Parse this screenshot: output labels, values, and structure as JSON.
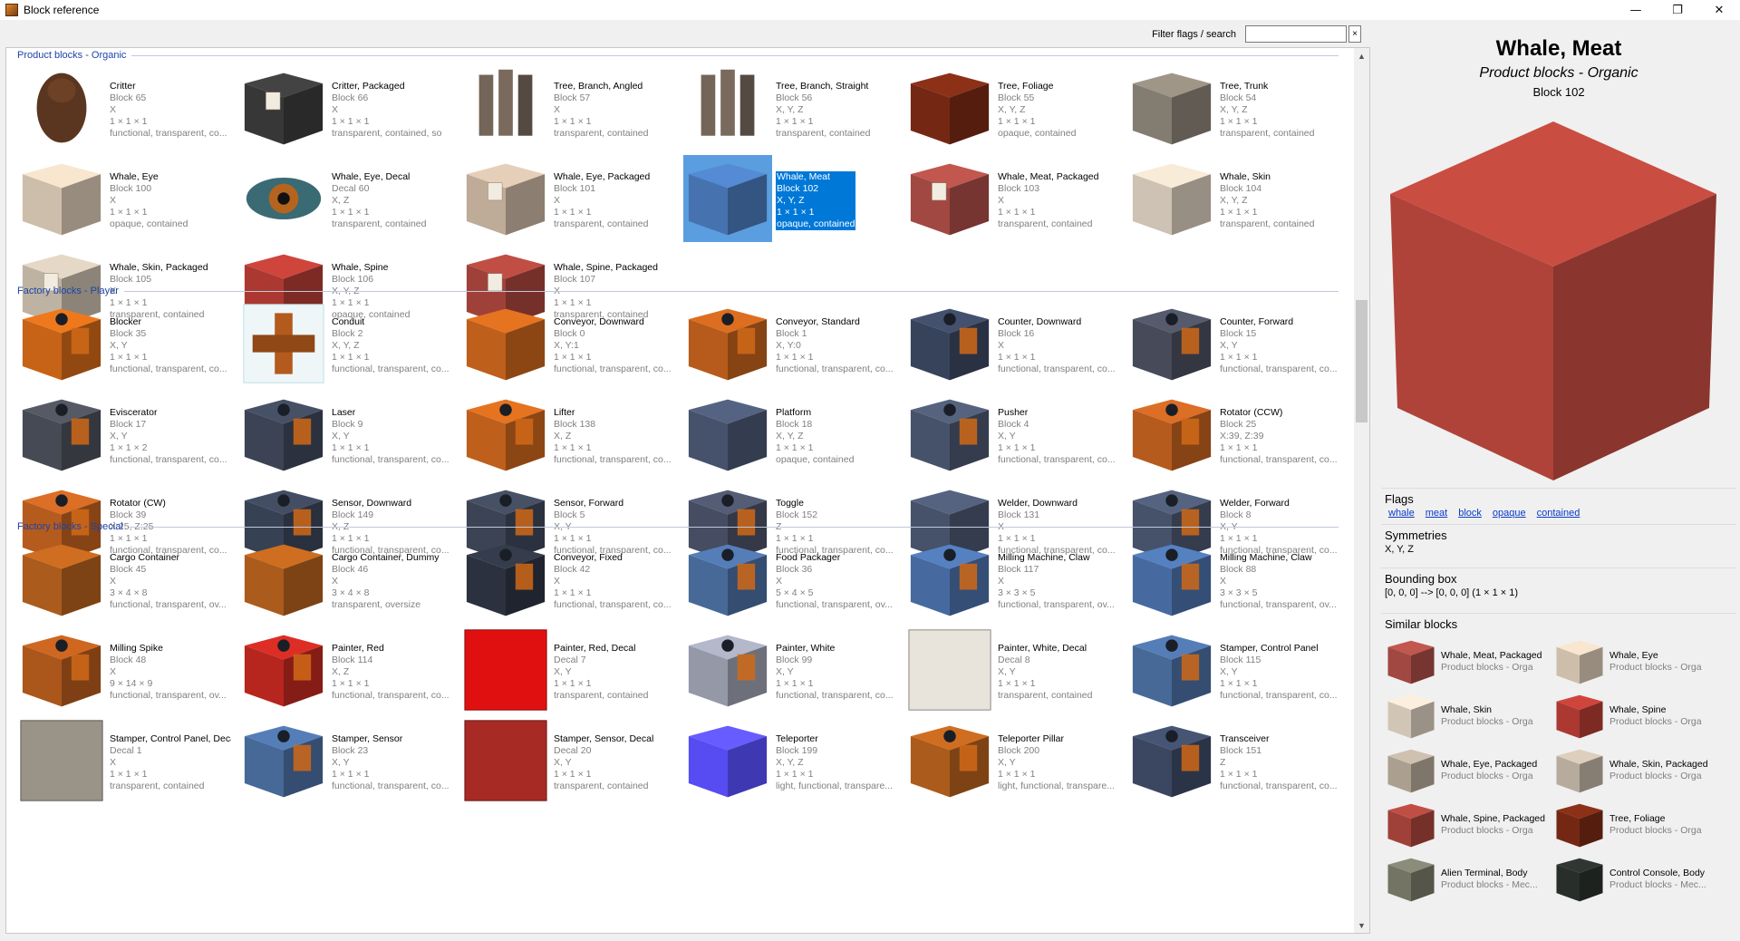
{
  "window": {
    "title": "Block reference",
    "minimize": "—",
    "maximize": "❐",
    "close": "✕"
  },
  "filter": {
    "label": "Filter flags / search",
    "value": "",
    "clear": "×"
  },
  "categories": [
    {
      "title": "Product blocks - Organic",
      "items": [
        {
          "name": "Critter",
          "block": "Block 65",
          "sym": "X",
          "size": "1 × 1 × 1",
          "flags": "functional, transparent, co...",
          "color": "#5a3620",
          "shape": "critter"
        },
        {
          "name": "Critter, Packaged",
          "block": "Block 66",
          "sym": "X",
          "size": "1 × 1 × 1",
          "flags": "transparent, contained, so",
          "color": "#3a3a3a",
          "shape": "package"
        },
        {
          "name": "Tree, Branch, Angled",
          "block": "Block 57",
          "sym": "X",
          "size": "1 × 1 × 1",
          "flags": "transparent, contained",
          "color": "#7a6a5e",
          "shape": "posts"
        },
        {
          "name": "Tree, Branch, Straight",
          "block": "Block 56",
          "sym": "X, Y, Z",
          "size": "1 × 1 × 1",
          "flags": "transparent, contained",
          "color": "#7a6a5e",
          "shape": "posts"
        },
        {
          "name": "Tree, Foliage",
          "block": "Block 55",
          "sym": "X, Y, Z",
          "size": "1 × 1 × 1",
          "flags": "opaque, contained",
          "color": "#7a2a14",
          "shape": "cube"
        },
        {
          "name": "Tree, Trunk",
          "block": "Block 54",
          "sym": "X, Y, Z",
          "size": "1 × 1 × 1",
          "flags": "transparent, contained",
          "color": "#8a8276",
          "shape": "cube"
        },
        {
          "name": "Whale, Eye",
          "block": "Block 100",
          "sym": "X",
          "size": "1 × 1 × 1",
          "flags": "opaque, contained",
          "color": "#d8c8b4",
          "shape": "cube"
        },
        {
          "name": "Whale, Eye, Decal",
          "block": "Decal 60",
          "sym": "X, Z",
          "size": "1 × 1 × 1",
          "flags": "transparent, contained",
          "color": "#b4641e",
          "shape": "eye"
        },
        {
          "name": "Whale, Eye, Packaged",
          "block": "Block 101",
          "sym": "X",
          "size": "1 × 1 × 1",
          "flags": "transparent, contained",
          "color": "#c8b4a0",
          "shape": "package"
        },
        {
          "name": "Whale, Meat",
          "block": "Block 102",
          "sym": "X, Y, Z",
          "size": "1 × 1 × 1",
          "flags": "opaque, contained",
          "color": "#4a78b8",
          "shape": "cube",
          "selected": true
        },
        {
          "name": "Whale, Meat, Packaged",
          "block": "Block 103",
          "sym": "X",
          "size": "1 × 1 × 1",
          "flags": "transparent, contained",
          "color": "#a84c44",
          "shape": "package"
        },
        {
          "name": "Whale, Skin",
          "block": "Block 104",
          "sym": "X, Y, Z",
          "size": "1 × 1 × 1",
          "flags": "transparent, contained",
          "color": "#d8ccbc",
          "shape": "cube"
        },
        {
          "name": "Whale, Skin, Packaged",
          "block": "Block 105",
          "sym": "X",
          "size": "1 × 1 × 1",
          "flags": "transparent, contained",
          "color": "#c8bcac",
          "shape": "package"
        },
        {
          "name": "Whale, Spine",
          "block": "Block 106",
          "sym": "X, Y, Z",
          "size": "1 × 1 × 1",
          "flags": "opaque, contained",
          "color": "#b43c34",
          "shape": "cube"
        },
        {
          "name": "Whale, Spine, Packaged",
          "block": "Block 107",
          "sym": "X",
          "size": "1 × 1 × 1",
          "flags": "transparent, contained",
          "color": "#a8443c",
          "shape": "package"
        }
      ]
    },
    {
      "title": "Factory blocks - Player",
      "items": [
        {
          "name": "Blocker",
          "block": "Block 35",
          "sym": "X, Y",
          "size": "1 × 1 × 1",
          "flags": "functional, transparent, co...",
          "color": "#d06818",
          "shape": "machine"
        },
        {
          "name": "Conduit",
          "block": "Block 2",
          "sym": "X, Y, Z",
          "size": "1 × 1 × 1",
          "flags": "functional, transparent, co...",
          "color": "#b45a1c",
          "shape": "conduit"
        },
        {
          "name": "Conveyor, Downward",
          "block": "Block 0",
          "sym": "X, Y:1",
          "size": "1 × 1 × 1",
          "flags": "functional, transparent, co...",
          "color": "#c8641c",
          "shape": "cube"
        },
        {
          "name": "Conveyor, Standard",
          "block": "Block 1",
          "sym": "X, Y:0",
          "size": "1 × 1 × 1",
          "flags": "functional, transparent, co...",
          "color": "#c0601c",
          "shape": "machine"
        },
        {
          "name": "Counter, Downward",
          "block": "Block 16",
          "sym": "X",
          "size": "1 × 1 × 1",
          "flags": "functional, transparent, co...",
          "color": "#3a4660",
          "shape": "machine"
        },
        {
          "name": "Counter, Forward",
          "block": "Block 15",
          "sym": "X, Y",
          "size": "1 × 1 × 1",
          "flags": "functional, transparent, co...",
          "color": "#4a4e5e",
          "shape": "machine"
        },
        {
          "name": "Eviscerator",
          "block": "Block 17",
          "sym": "X, Y",
          "size": "1 × 1 × 2",
          "flags": "functional, transparent, co...",
          "color": "#4a4e58",
          "shape": "machine"
        },
        {
          "name": "Laser",
          "block": "Block 9",
          "sym": "X, Y",
          "size": "1 × 1 × 1",
          "flags": "functional, transparent, co...",
          "color": "#3e4658",
          "shape": "machine"
        },
        {
          "name": "Lifter",
          "block": "Block 138",
          "sym": "X, Z",
          "size": "1 × 1 × 1",
          "flags": "functional, transparent, co...",
          "color": "#c8641c",
          "shape": "machine"
        },
        {
          "name": "Platform",
          "block": "Block 18",
          "sym": "X, Y, Z",
          "size": "1 × 1 × 1",
          "flags": "opaque, contained",
          "color": "#4a5672",
          "shape": "cube"
        },
        {
          "name": "Pusher",
          "block": "Block 4",
          "sym": "X, Y",
          "size": "1 × 1 × 1",
          "flags": "functional, transparent, co...",
          "color": "#4a566e",
          "shape": "machine"
        },
        {
          "name": "Rotator (CCW)",
          "block": "Block 25",
          "sym": "X:39, Z:39",
          "size": "1 × 1 × 1",
          "flags": "functional, transparent, co...",
          "color": "#c06020",
          "shape": "machine"
        },
        {
          "name": "Rotator (CW)",
          "block": "Block 39",
          "sym": "X:25, Z:25",
          "size": "1 × 1 × 1",
          "flags": "functional, transparent, co...",
          "color": "#c06020",
          "shape": "machine"
        },
        {
          "name": "Sensor, Downward",
          "block": "Block 149",
          "sym": "X, Z",
          "size": "1 × 1 × 1",
          "flags": "functional, transparent, co...",
          "color": "#3a4458",
          "shape": "machine"
        },
        {
          "name": "Sensor, Forward",
          "block": "Block 5",
          "sym": "X, Y",
          "size": "1 × 1 × 1",
          "flags": "functional, transparent, co...",
          "color": "#3e4658",
          "shape": "machine"
        },
        {
          "name": "Toggle",
          "block": "Block 152",
          "sym": "Z",
          "size": "1 × 1 × 1",
          "flags": "functional, transparent, co...",
          "color": "#4a5066",
          "shape": "machine"
        },
        {
          "name": "Welder, Downward",
          "block": "Block 131",
          "sym": "X",
          "size": "1 × 1 × 1",
          "flags": "functional, transparent, co...",
          "color": "#4a5670",
          "shape": "cube"
        },
        {
          "name": "Welder, Forward",
          "block": "Block 8",
          "sym": "X, Y",
          "size": "1 × 1 × 1",
          "flags": "functional, transparent, co...",
          "color": "#4a5670",
          "shape": "machine"
        }
      ]
    },
    {
      "title": "Factory blocks - Special",
      "items": [
        {
          "name": "Cargo Container",
          "block": "Block 45",
          "sym": "X",
          "size": "3 × 4 × 8",
          "flags": "functional, transparent, ov...",
          "color": "#b4601c",
          "shape": "cube"
        },
        {
          "name": "Cargo Container, Dummy",
          "block": "Block 46",
          "sym": "X",
          "size": "3 × 4 × 8",
          "flags": "transparent, oversize",
          "color": "#b4601c",
          "shape": "cube"
        },
        {
          "name": "Conveyor, Fixed",
          "block": "Block 42",
          "sym": "X",
          "size": "1 × 1 × 1",
          "flags": "functional, transparent, co...",
          "color": "#2e3442",
          "shape": "machine"
        },
        {
          "name": "Food Packager",
          "block": "Block 36",
          "sym": "X",
          "size": "5 × 4 × 5",
          "flags": "functional, transparent, ov...",
          "color": "#4a6ea0",
          "shape": "machine"
        },
        {
          "name": "Milling Machine, Claw",
          "block": "Block 117",
          "sym": "X",
          "size": "3 × 3 × 5",
          "flags": "functional, transparent, ov...",
          "color": "#4a70a8",
          "shape": "machine"
        },
        {
          "name": "Milling Machine, Claw",
          "block": "Block 88",
          "sym": "X",
          "size": "3 × 3 × 5",
          "flags": "functional, transparent, ov...",
          "color": "#4a70a8",
          "shape": "machine"
        },
        {
          "name": "Milling Spike",
          "block": "Block 48",
          "sym": "X",
          "size": "9 × 14 × 9",
          "flags": "functional, transparent, ov...",
          "color": "#b45a1c",
          "shape": "machine"
        },
        {
          "name": "Painter, Red",
          "block": "Block 114",
          "sym": "X, Z",
          "size": "1 × 1 × 1",
          "flags": "functional, transparent, co...",
          "color": "#c02820",
          "shape": "machine"
        },
        {
          "name": "Painter, Red, Decal",
          "block": "Decal 7",
          "sym": "X, Y",
          "size": "1 × 1 × 1",
          "flags": "transparent, contained",
          "color": "#e01010",
          "shape": "flat"
        },
        {
          "name": "Painter, White",
          "block": "Block 99",
          "sym": "X, Y",
          "size": "1 × 1 × 1",
          "flags": "functional, transparent, co...",
          "color": "#9ca0b0",
          "shape": "machine"
        },
        {
          "name": "Painter, White, Decal",
          "block": "Decal 8",
          "sym": "X, Y",
          "size": "1 × 1 × 1",
          "flags": "transparent, contained",
          "color": "#e8e4dc",
          "shape": "flat"
        },
        {
          "name": "Stamper, Control Panel",
          "block": "Block 115",
          "sym": "X, Y",
          "size": "1 × 1 × 1",
          "flags": "functional, transparent, co...",
          "color": "#4a6ea0",
          "shape": "machine"
        },
        {
          "name": "Stamper, Control Panel, Decal",
          "block": "Decal 1",
          "sym": "X",
          "size": "1 × 1 × 1",
          "flags": "transparent, contained",
          "color": "#9a9488",
          "shape": "flat"
        },
        {
          "name": "Stamper, Sensor",
          "block": "Block 23",
          "sym": "X, Y",
          "size": "1 × 1 × 1",
          "flags": "functional, transparent, co...",
          "color": "#4a6ea0",
          "shape": "machine"
        },
        {
          "name": "Stamper, Sensor, Decal",
          "block": "Decal 20",
          "sym": "X, Y",
          "size": "1 × 1 × 1",
          "flags": "transparent, contained",
          "color": "#a82a24",
          "shape": "flat"
        },
        {
          "name": "Teleporter",
          "block": "Block 199",
          "sym": "X, Y, Z",
          "size": "1 × 1 × 1",
          "flags": "light, functional, transpare...",
          "color": "#5a50ff",
          "shape": "cube"
        },
        {
          "name": "Teleporter Pillar",
          "block": "Block 200",
          "sym": "X, Y",
          "size": "1 × 1 × 1",
          "flags": "light, functional, transpare...",
          "color": "#b4601c",
          "shape": "machine"
        },
        {
          "name": "Transceiver",
          "block": "Block 151",
          "sym": "Z",
          "size": "1 × 1 × 1",
          "flags": "functional, transparent, co...",
          "color": "#3e4a66",
          "shape": "machine"
        }
      ]
    }
  ],
  "detail": {
    "title": "Whale, Meat",
    "category": "Product blocks - Organic",
    "block": "Block 102",
    "preview_color": "#b8463c",
    "flags_label": "Flags",
    "flags": [
      "whale",
      "meat",
      "block",
      "opaque",
      "contained"
    ],
    "symmetries_label": "Symmetries",
    "symmetries": "X, Y, Z",
    "bbox_label": "Bounding box",
    "bbox": "[0, 0, 0] --> [0, 0, 0] (1 × 1 × 1)",
    "similar_label": "Similar blocks",
    "similar": [
      {
        "name": "Whale, Meat, Packaged",
        "cat": "Product blocks - Orga",
        "color": "#a84c44"
      },
      {
        "name": "Whale, Eye",
        "cat": "Product blocks - Orga",
        "color": "#d8c8b4"
      },
      {
        "name": "Whale, Skin",
        "cat": "Product blocks - Orga",
        "color": "#dcd0c0"
      },
      {
        "name": "Whale, Spine",
        "cat": "Product blocks - Orga",
        "color": "#b43c34"
      },
      {
        "name": "Whale, Eye, Packaged",
        "cat": "Product blocks - Orga",
        "color": "#b4a898"
      },
      {
        "name": "Whale, Skin, Packaged",
        "cat": "Product blocks - Orga",
        "color": "#c0b4a4"
      },
      {
        "name": "Whale, Spine, Packaged",
        "cat": "Product blocks - Orga",
        "color": "#a8443c"
      },
      {
        "name": "Tree, Foliage",
        "cat": "Product blocks - Orga",
        "color": "#7a2a14"
      },
      {
        "name": "Alien Terminal, Body",
        "cat": "Product blocks - Mec...",
        "color": "#7a7a6a"
      },
      {
        "name": "Control Console, Body",
        "cat": "Product blocks - Mec...",
        "color": "#2a302c"
      }
    ]
  }
}
